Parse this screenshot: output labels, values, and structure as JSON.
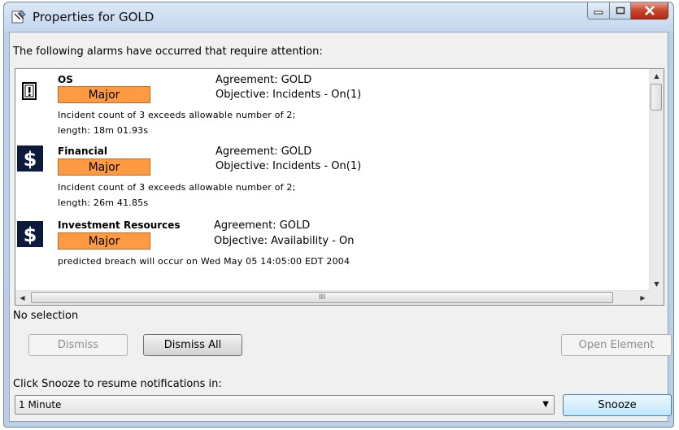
{
  "window": {
    "title": "Properties for GOLD"
  },
  "header_text": "The following alarms have occurred that require attention:",
  "alarms": [
    {
      "name": "OS",
      "severity": "Major",
      "agreement": "Agreement: GOLD",
      "objective": "Objective: Incidents - On(1)",
      "message_1": "Incident count of 3 exceeds allowable number of 2;",
      "message_2": "length: 18m 01.93s",
      "icon": "server-alert-icon"
    },
    {
      "name": "Financial",
      "severity": "Major",
      "agreement": "Agreement: GOLD",
      "objective": "Objective: Incidents - On(1)",
      "message_1": "Incident count of 3 exceeds allowable number of 2;",
      "message_2": "length: 26m 41.85s",
      "icon": "dollar-icon"
    },
    {
      "name": "Investment Resources",
      "severity": "Major",
      "agreement": "Agreement: GOLD",
      "objective": "Objective: Availability - On",
      "message_1": "predicted breach will occur on Wed May 05 14:05:00 EDT 2004",
      "icon": "dollar-icon"
    }
  ],
  "scroll_grip": "III",
  "status_text": "No selection",
  "buttons": {
    "dismiss": "Dismiss",
    "dismiss_all": "Dismiss All",
    "open_element": "Open Element",
    "snooze": "Snooze"
  },
  "snooze_label": "Click Snooze to resume notifications in:",
  "snooze_select": {
    "value": "1 Minute"
  },
  "colors": {
    "severity_major": "#fe9a41",
    "dollar_icon_bg": "#0c1a3d"
  }
}
